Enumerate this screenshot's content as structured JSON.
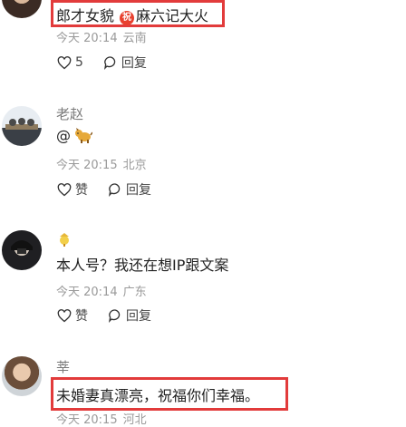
{
  "comments": [
    {
      "name": "",
      "text_before_badge": "郎才女貌",
      "badge_glyph": "祝",
      "text_after_badge": "麻六记大火",
      "time": "今天 20:14",
      "location": "云南",
      "likes": "5",
      "reply_label": "回复"
    },
    {
      "name": "老赵",
      "text": "@",
      "time": "今天 20:15",
      "location": "北京",
      "like_label": "赞",
      "reply_label": "回复"
    },
    {
      "name": "",
      "text": "本人号？我还在想IP跟文案",
      "time": "今天 20:14",
      "location": "广东",
      "like_label": "赞",
      "reply_label": "回复"
    },
    {
      "name": "莘",
      "text": "未婚妻真漂亮，祝福你们幸福。",
      "time": "今天 20:15",
      "location": "河北"
    }
  ],
  "colors": {
    "highlight_box": "#e23b3b",
    "badge": "#e8412f",
    "meta_text": "#9a9a9a"
  },
  "icons": [
    "heart-icon",
    "comment-bubble-icon",
    "dog-emoji",
    "chick-emoji",
    "congrats-badge-icon"
  ]
}
